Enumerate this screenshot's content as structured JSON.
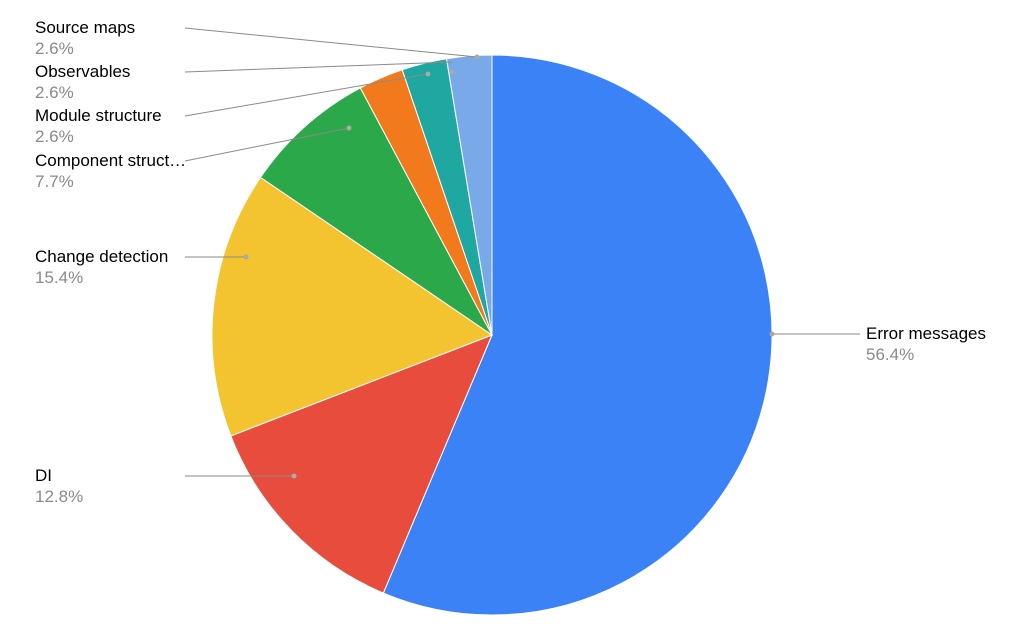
{
  "chart_data": {
    "type": "pie",
    "series": [
      {
        "name": "Error messages",
        "value": 56.4,
        "percent_label": "56.4%",
        "color": "#3b82f6"
      },
      {
        "name": "DI",
        "value": 12.8,
        "percent_label": "12.8%",
        "color": "#e74c3c"
      },
      {
        "name": "Change detection",
        "value": 15.4,
        "percent_label": "15.4%",
        "color": "#f4c430"
      },
      {
        "name": "Component struct…",
        "value": 7.7,
        "percent_label": "7.7%",
        "color": "#2ba84a"
      },
      {
        "name": "Module structure",
        "value": 2.6,
        "percent_label": "2.6%",
        "color": "#f37a1c"
      },
      {
        "name": "Observables",
        "value": 2.6,
        "percent_label": "2.6%",
        "color": "#1fa7a1"
      },
      {
        "name": "Source maps",
        "value": 2.6,
        "percent_label": "2.6%",
        "color": "#7aa9e9"
      }
    ]
  },
  "labels": {
    "lbl0": {
      "name": "Error messages",
      "pct": "56.4%"
    },
    "lbl1": {
      "name": "DI",
      "pct": "12.8%"
    },
    "lbl2": {
      "name": "Change detection",
      "pct": "15.4%"
    },
    "lbl3": {
      "name": "Component struct…",
      "pct": "7.7%"
    },
    "lbl4": {
      "name": "Module structure",
      "pct": "2.6%"
    },
    "lbl5": {
      "name": "Observables",
      "pct": "2.6%"
    },
    "lbl6": {
      "name": "Source maps",
      "pct": "2.6%"
    }
  }
}
